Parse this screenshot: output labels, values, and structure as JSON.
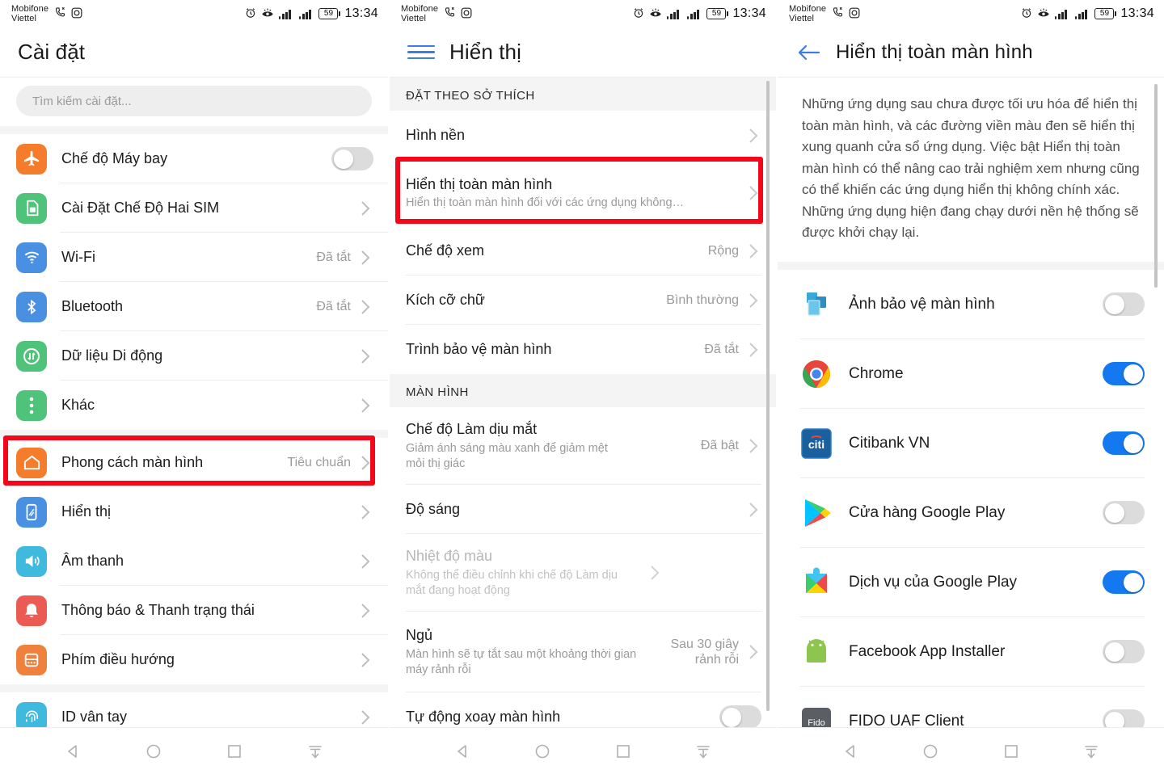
{
  "statusbar": {
    "carrier1": "Mobifone",
    "carrier2": "Viettel",
    "battery": "59",
    "time": "13:34",
    "icons": [
      "call-mute-icon",
      "camera-icon",
      "alarm-icon",
      "eye-comfort-icon",
      "signal-icon",
      "signal-icon",
      "battery-icon"
    ]
  },
  "colors": {
    "accent_blue": "#1478f0",
    "highlight_red": "#f4071a",
    "toggle_off": "#dcdcdc",
    "section_bg": "#f4f4f4"
  },
  "panel1": {
    "title": "Cài đặt",
    "search_placeholder": "Tìm kiếm cài đặt...",
    "items": [
      {
        "label": "Chế độ Máy bay",
        "icon": "airplane-icon",
        "color": "#f57c2b",
        "control": "toggle",
        "on": false
      },
      {
        "label": "Cài Đặt Chế Độ Hai SIM",
        "icon": "sim-card-icon",
        "color": "#4fc37a",
        "control": "chevron"
      },
      {
        "label": "Wi-Fi",
        "icon": "wifi-icon",
        "color": "#4a90e2",
        "value": "Đã tắt",
        "control": "chevron"
      },
      {
        "label": "Bluetooth",
        "icon": "bluetooth-icon",
        "color": "#4a90e2",
        "value": "Đã tắt",
        "control": "chevron"
      },
      {
        "label": "Dữ liệu Di động",
        "icon": "mobile-data-icon",
        "color": "#4fc37a",
        "control": "chevron"
      },
      {
        "label": "Khác",
        "icon": "more-dots-icon",
        "color": "#4fc37a",
        "control": "chevron"
      }
    ],
    "items2": [
      {
        "label": "Phong cách màn hình",
        "icon": "home-style-icon",
        "color": "#f57c2b",
        "value": "Tiêu chuẩn",
        "control": "chevron"
      },
      {
        "label": "Hiển thị",
        "icon": "display-icon",
        "color": "#4a90e2",
        "control": "chevron",
        "highlighted": true
      },
      {
        "label": "Âm thanh",
        "icon": "sound-icon",
        "color": "#3fb9de",
        "control": "chevron"
      },
      {
        "label": "Thông báo & Thanh trạng thái",
        "icon": "bell-icon",
        "color": "#ec5b53",
        "control": "chevron"
      },
      {
        "label": "Phím điều hướng",
        "icon": "navkeys-icon",
        "color": "#f0813c",
        "control": "chevron"
      }
    ],
    "items3": [
      {
        "label": "ID vân tay",
        "icon": "fingerprint-icon",
        "color": "#3fb9de",
        "control": "chevron"
      }
    ]
  },
  "panel2": {
    "title": "Hiển thị",
    "menu_icon": "hamburger-icon",
    "section1_title": "ĐẶT THEO SỞ THÍCH",
    "section1_items": [
      {
        "label": "Hình nền",
        "control": "chevron"
      },
      {
        "label": "Hiển thị toàn màn hình",
        "sub": "Hiển thị toàn màn hình đối với các ứng dụng không…",
        "control": "chevron",
        "highlighted": true
      },
      {
        "label": "Chế độ xem",
        "value": "Rộng",
        "control": "chevron"
      },
      {
        "label": "Kích cỡ chữ",
        "value": "Bình thường",
        "control": "chevron"
      },
      {
        "label": "Trình bảo vệ màn hình",
        "value": "Đã tắt",
        "control": "chevron"
      }
    ],
    "section2_title": "MÀN HÌNH",
    "section2_items": [
      {
        "label": "Chế độ Làm dịu mắt",
        "sub": "Giảm ánh sáng màu xanh để giảm mệt mỏi thị giác",
        "value": "Đã bật",
        "control": "chevron"
      },
      {
        "label": "Độ sáng",
        "control": "chevron"
      },
      {
        "label": "Nhiệt độ màu",
        "sub": "Không thể điều chỉnh khi chế độ Làm dịu mắt đang hoạt động",
        "control": "chevron",
        "disabled": true
      },
      {
        "label": "Ngủ",
        "sub": "Màn hình sẽ tự tắt sau một khoảng thời gian máy rảnh rỗi",
        "value": "Sau 30 giây rảnh rỗi",
        "control": "chevron"
      },
      {
        "label": "Tự động xoay màn hình",
        "control": "toggle",
        "on": false
      }
    ]
  },
  "panel3": {
    "title": "Hiển thị toàn màn hình",
    "back_icon": "back-arrow-icon",
    "description": "Những ứng dụng sau chưa được tối ưu hóa để hiển thị toàn màn hình, và các đường viền màu đen sẽ hiển thị xung quanh cửa sổ ứng dụng. Việc bật Hiển thị toàn màn hình có thể nâng cao trải nghiệm xem nhưng cũng có thể khiến các ứng dụng hiển thị không chính xác. Những ứng dụng hiện đang chạy dưới nền hệ thống sẽ được khởi chạy lại.",
    "apps": [
      {
        "label": "Ảnh bảo vệ màn hình",
        "icon": "screensaver-icon",
        "on": false
      },
      {
        "label": "Chrome",
        "icon": "chrome-icon",
        "on": true
      },
      {
        "label": "Citibank VN",
        "icon": "citibank-icon",
        "on": true
      },
      {
        "label": "Cửa hàng Google Play",
        "icon": "google-play-icon",
        "on": false
      },
      {
        "label": "Dịch vụ của Google Play",
        "icon": "google-play-services-icon",
        "on": true
      },
      {
        "label": "Facebook App Installer",
        "icon": "android-icon",
        "on": false
      },
      {
        "label": "FIDO UAF Client",
        "icon": "fido-icon",
        "on": false
      }
    ]
  },
  "navbar": {
    "items": [
      {
        "name": "back-nav-button",
        "icon": "triangle-back-icon"
      },
      {
        "name": "home-nav-button",
        "icon": "circle-home-icon"
      },
      {
        "name": "recents-nav-button",
        "icon": "square-recents-icon"
      },
      {
        "name": "pulldown-nav-button",
        "icon": "pulldown-icon"
      }
    ]
  }
}
